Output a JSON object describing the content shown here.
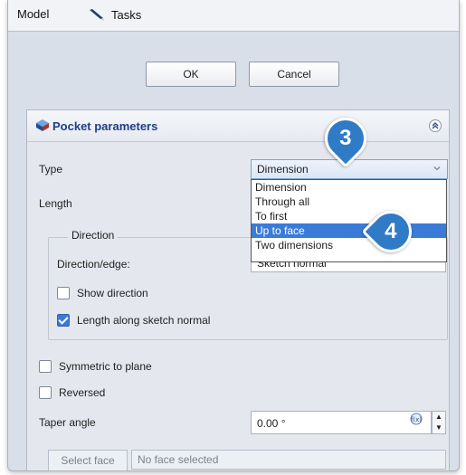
{
  "tabs": {
    "model": "Model",
    "tasks": "Tasks"
  },
  "buttons": {
    "ok": "OK",
    "cancel": "Cancel"
  },
  "panel": {
    "title": "Pocket parameters",
    "type_label": "Type",
    "type_value": "Dimension",
    "length_label": "Length",
    "direction_group": "Direction",
    "direction_edge_label": "Direction/edge:",
    "direction_edge_value": "Sketch normal",
    "show_direction": "Show direction",
    "length_along_normal": "Length along sketch normal",
    "symmetric": "Symmetric to plane",
    "reversed": "Reversed",
    "taper_label": "Taper angle",
    "taper_value": "0.00 °",
    "select_face": "Select face",
    "face_placeholder": "No face selected"
  },
  "dropdown": {
    "options": [
      "Dimension",
      "Through all",
      "To first",
      "Up to face",
      "Two dimensions"
    ],
    "selected_index": 3
  },
  "checkboxes": {
    "show_direction": false,
    "length_along_normal": true,
    "symmetric": false,
    "reversed": false
  },
  "callouts": {
    "step3": "3",
    "step4": "4"
  },
  "colors": {
    "accent": "#3b7bd8",
    "callout": "#2f7bc6",
    "title": "#1f3f86"
  }
}
